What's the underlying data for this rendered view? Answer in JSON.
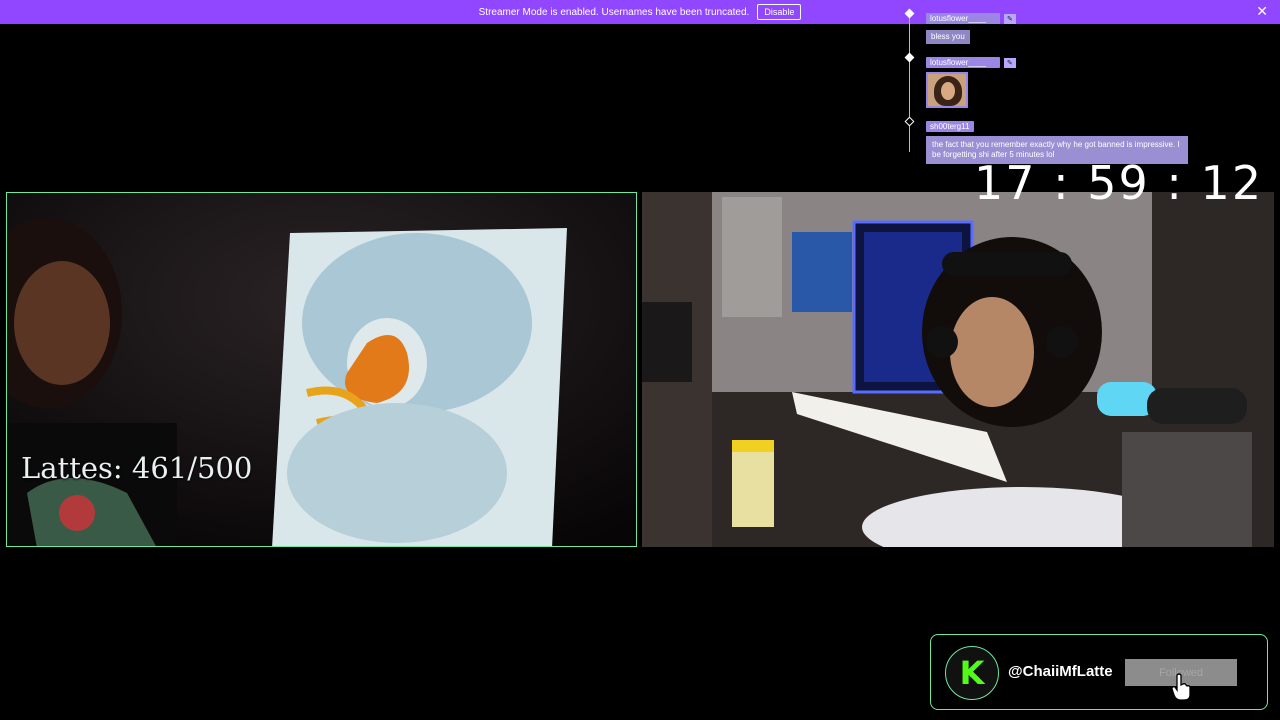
{
  "banner": {
    "message": "Streamer Mode is enabled. Usernames have been truncated.",
    "disable_label": "Disable",
    "close_glyph": "✕"
  },
  "chat": {
    "messages": [
      {
        "user": "lotusflower____",
        "badge": "✎",
        "text": "bless you"
      },
      {
        "user": "lotusflower____",
        "badge": "✎",
        "image": "emote-portrait"
      },
      {
        "user": "sh00terg11",
        "text": "the fact that you remember exactly why he got banned is impressive. I be forgetting shi after 5 minutes lol"
      }
    ]
  },
  "timer": {
    "value": "17 : 59 : 12"
  },
  "left_cam": {
    "overlay_text": "Lattes: 461/500"
  },
  "follow": {
    "logo_letter": "K",
    "handle": "@ChaiiMfLatte",
    "button_label": "Followed"
  },
  "colors": {
    "banner": "#9147ff",
    "accent_green": "#6ee7a0",
    "kick_green": "#53fc18",
    "chat_name_bg": "#9b86e6"
  }
}
